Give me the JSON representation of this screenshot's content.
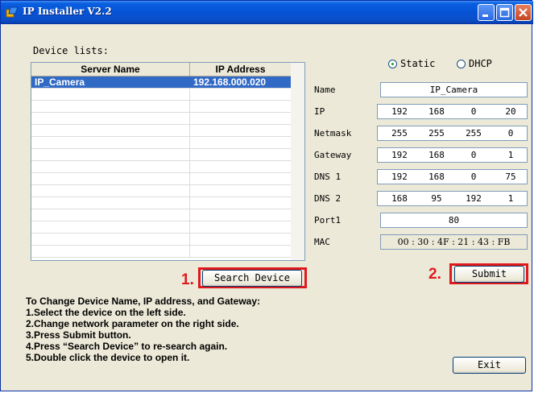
{
  "window": {
    "title": "IP Installer V2.2"
  },
  "device_list": {
    "label": "Device lists:",
    "columns": [
      "Server Name",
      "IP Address"
    ],
    "rows": [
      {
        "name": "IP_Camera",
        "ip": "192.168.000.020",
        "selected": true
      }
    ]
  },
  "network": {
    "mode_options": {
      "static": "Static",
      "dhcp": "DHCP"
    },
    "selected_mode": "Static",
    "labels": {
      "name": "Name",
      "ip": "IP",
      "netmask": "Netmask",
      "gateway": "Gateway",
      "dns1": "DNS 1",
      "dns2": "DNS 2",
      "port": "Port1",
      "mac": "MAC"
    },
    "name": "IP_Camera",
    "ip": [
      "192",
      "168",
      "0",
      "20"
    ],
    "netmask": [
      "255",
      "255",
      "255",
      "0"
    ],
    "gateway": [
      "192",
      "168",
      "0",
      "1"
    ],
    "dns1": [
      "192",
      "168",
      "0",
      "75"
    ],
    "dns2": [
      "168",
      "95",
      "192",
      "1"
    ],
    "port": "80",
    "mac": "00 : 30 : 4F : 21 : 43 : FB"
  },
  "buttons": {
    "search": "Search Device",
    "submit": "Submit",
    "exit": "Exit"
  },
  "annotations": {
    "step1": "1.",
    "step2": "2.",
    "color": "#e0191c"
  },
  "instructions": [
    "To Change Device Name, IP address, and Gateway:",
    "1.Select the device on the left side.",
    "2.Change network parameter on the right side.",
    "3.Press Submit button.",
    "4.Press “Search Device” to re-search again.",
    "5.Double click the device to open it."
  ],
  "icons": {
    "app": "app-icon",
    "minimize": "minimize-icon",
    "maximize": "maximize-icon",
    "close": "close-icon"
  }
}
